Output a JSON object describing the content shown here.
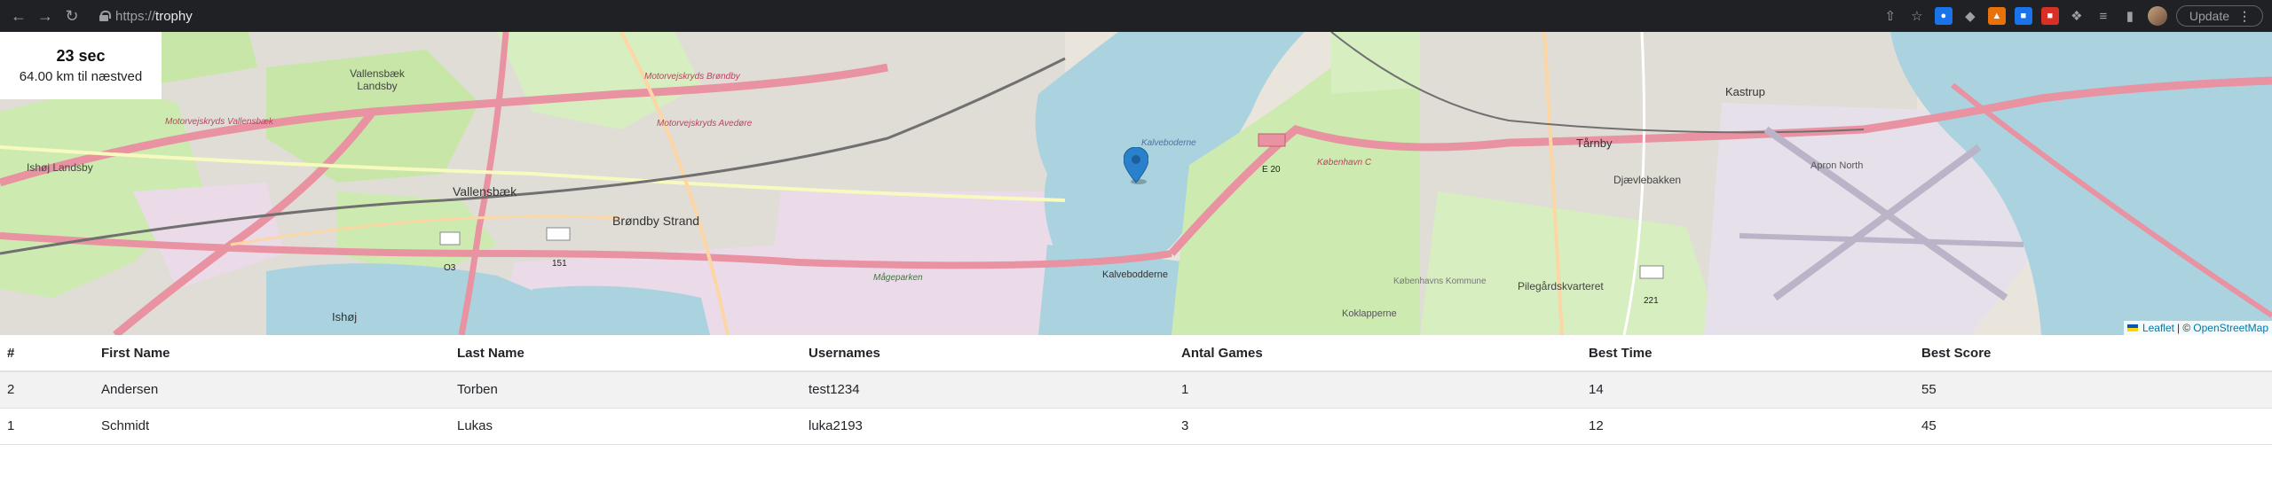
{
  "browser": {
    "url_scheme": "https://",
    "url_host": "trophy",
    "update_label": "Update",
    "back_icon": "arrow-left-icon",
    "forward_icon": "arrow-right-icon",
    "reload_icon": "reload-icon"
  },
  "map": {
    "info": {
      "time": "23 sec",
      "distance": "64.00 km til næstved"
    },
    "attribution": {
      "leaflet": "Leaflet",
      "separator": "| ©",
      "osm": "OpenStreetMap"
    },
    "labels": {
      "vallensbaek_landsby": "Vallensbæk Landsby",
      "ishoj_landsby": "Ishøj Landsby",
      "vallensbaek": "Vallensbæk",
      "brondby_strand": "Brøndby Strand",
      "ishoj": "Ishøj",
      "kalvebodderne": "Kalvebodderne",
      "kastrup": "Kastrup",
      "tarnby": "Tårnby",
      "kagelehaven": "Djævlebakken",
      "pilegardskvarteret": "Pilegårdskvarteret",
      "koklapperne": "Koklapperne",
      "apron_north": "Apron North",
      "kalvebodstrand": "Kalveboderne",
      "road_151": "151",
      "road_221": "221",
      "road_e20": "E 20",
      "road_o3": "O3",
      "motorvej_brondby": "Motorvejskryds Brøndby",
      "motorvej_avedore": "Motorvejskryds Avedøre",
      "motorvej_vallensbaek": "Motorvejskryds Vallensbæk",
      "kobenhavn_c": "København C",
      "mogeparken": "Mågeparken",
      "kobenhavns_kommune": "Københavns Kommune"
    }
  },
  "table": {
    "headers": [
      "#",
      "First Name",
      "Last Name",
      "Usernames",
      "Antal Games",
      "Best Time",
      "Best Score"
    ],
    "rows": [
      [
        "2",
        "Andersen",
        "Torben",
        "test1234",
        "1",
        "14",
        "55"
      ],
      [
        "1",
        "Schmidt",
        "Lukas",
        "luka2193",
        "3",
        "12",
        "45"
      ]
    ]
  },
  "colors": {
    "chrome_bg": "#202124",
    "water": "#aad3df",
    "motorway": "#e892a2",
    "park": "#cdebb0",
    "marker": "#2a81cb"
  }
}
